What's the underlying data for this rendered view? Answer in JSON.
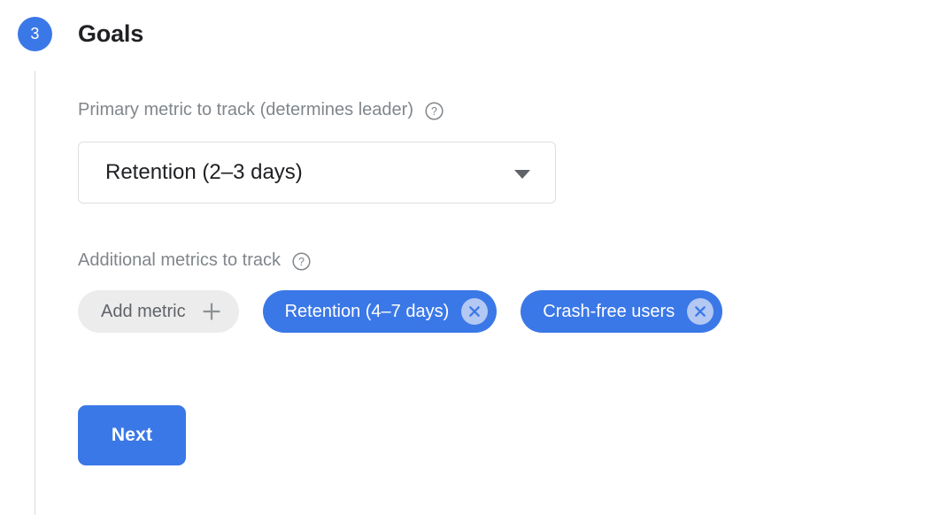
{
  "step": {
    "number": "3",
    "title": "Goals"
  },
  "primary_metric": {
    "label": "Primary metric to track (determines leader)",
    "help_icon": "help-circle-icon",
    "selected": "Retention (2–3 days)",
    "dropdown_icon": "chevron-down-icon"
  },
  "additional_metrics": {
    "label": "Additional metrics to track",
    "help_icon": "help-circle-icon",
    "add_chip": {
      "label": "Add metric",
      "icon": "plus-icon"
    },
    "chips": [
      {
        "label": "Retention (4–7 days)",
        "remove_icon": "close-circle-icon"
      },
      {
        "label": "Crash-free users",
        "remove_icon": "close-circle-icon"
      }
    ]
  },
  "actions": {
    "next_label": "Next"
  },
  "colors": {
    "accent": "#3b78e7",
    "chip_neutral_bg": "#ececec",
    "chip_remove_bg": "#b3c8f2",
    "label_text": "#80868b",
    "title_text": "#202124",
    "border": "#dcdfe3",
    "connector": "#dadce0"
  }
}
